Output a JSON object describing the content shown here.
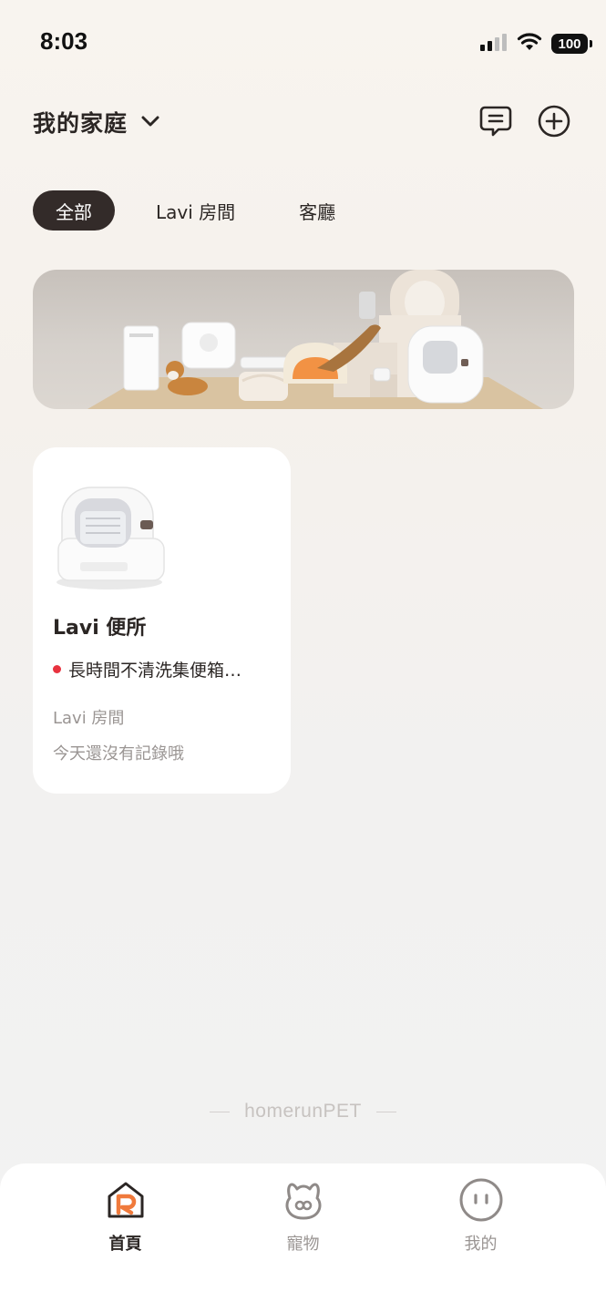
{
  "status_bar": {
    "time": "8:03",
    "battery": "100"
  },
  "header": {
    "home_title": "我的家庭"
  },
  "tabs": [
    {
      "label": "全部",
      "active": true
    },
    {
      "label": "Lavi 房間",
      "active": false
    },
    {
      "label": "客廳",
      "active": false
    }
  ],
  "devices": [
    {
      "name": "Lavi 便所",
      "alert": "長時間不清洗集便箱…",
      "room": "Lavi 房間",
      "record": "今天還沒有記錄哦"
    }
  ],
  "brand": "homerunPET",
  "bottom_nav": [
    {
      "label": "首頁",
      "icon": "home-r-icon",
      "active": true
    },
    {
      "label": "寵物",
      "icon": "pet-bunny-icon",
      "active": false
    },
    {
      "label": "我的",
      "icon": "profile-face-icon",
      "active": false
    }
  ],
  "colors": {
    "accent_dark": "#332b29",
    "alert_red": "#e8323f",
    "brand_orange": "#f07a3c",
    "muted_text": "#9a9593"
  }
}
